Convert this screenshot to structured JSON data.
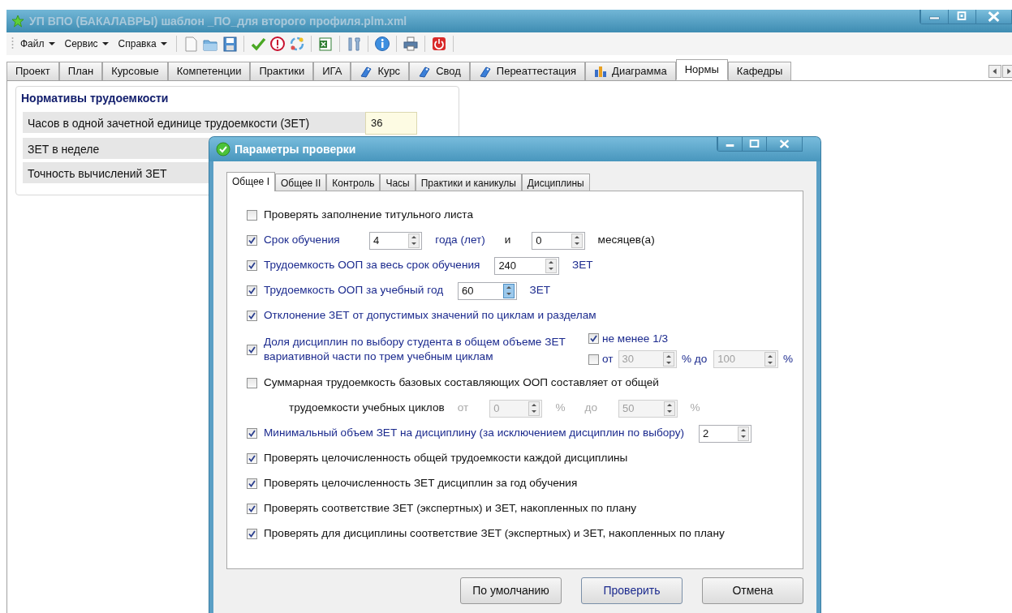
{
  "window": {
    "title": "УП ВПО (БАКАЛАВРЫ) шаблон _ПО_для второго профиля.plm.xml"
  },
  "menu": [
    {
      "label": "Файл"
    },
    {
      "label": "Сервис"
    },
    {
      "label": "Справка"
    }
  ],
  "tabs": [
    {
      "label": "Проект",
      "kind": "plain",
      "selected": false
    },
    {
      "label": "План",
      "kind": "plain",
      "selected": false
    },
    {
      "label": "Курсовые",
      "kind": "plain",
      "selected": false
    },
    {
      "label": "Компетенции",
      "kind": "plain",
      "selected": false
    },
    {
      "label": "Практики",
      "kind": "plain",
      "selected": false
    },
    {
      "label": "ИГА",
      "kind": "plain",
      "selected": false
    },
    {
      "label": "Курс",
      "kind": "tag",
      "selected": false
    },
    {
      "label": "Свод",
      "kind": "tag",
      "selected": false
    },
    {
      "label": "Переаттестация",
      "kind": "tag",
      "selected": false
    },
    {
      "label": "Диаграмма",
      "kind": "chart",
      "selected": false
    },
    {
      "label": "Нормы",
      "kind": "plain",
      "selected": true
    },
    {
      "label": "Кафедры",
      "kind": "plain",
      "selected": false
    }
  ],
  "norms": {
    "title": "Нормативы трудоемкости",
    "rows": [
      {
        "label": "Часов в одной зачетной единице трудоемкости (ЗЕТ)",
        "value": "36"
      },
      {
        "label": "ЗЕТ в неделе"
      },
      {
        "label": "Точность вычислений ЗЕТ"
      }
    ]
  },
  "dialog": {
    "title": "Параметры проверки",
    "tabs": [
      {
        "label": "Общее I",
        "selected": true
      },
      {
        "label": "Общее II",
        "selected": false
      },
      {
        "label": "Контроль",
        "selected": false
      },
      {
        "label": "Часы",
        "selected": false
      },
      {
        "label": "Практики и каникулы",
        "selected": false
      },
      {
        "label": "Дисциплины",
        "selected": false
      }
    ],
    "rows": [
      {
        "kind": "check",
        "checked": false,
        "accent": false,
        "label": "Проверять заполнение титульного листа"
      },
      {
        "kind": "check",
        "checked": true,
        "accent": true,
        "label": "Срок обучения",
        "items": [
          {
            "kind": "spin",
            "value": "4",
            "disabled": false,
            "hover": false
          },
          {
            "kind": "text",
            "text": "года (лет)",
            "accent": true,
            "disabled": false
          },
          {
            "kind": "text",
            "text": "и",
            "accent": false,
            "disabled": false
          },
          {
            "kind": "spin",
            "value": "0",
            "disabled": false,
            "hover": false
          },
          {
            "kind": "text",
            "text": "месяцев(а)",
            "accent": false,
            "disabled": false
          }
        ]
      },
      {
        "kind": "check",
        "checked": true,
        "accent": true,
        "label": "Трудоемкость ООП за весь срок обучения",
        "items": [
          {
            "kind": "spin",
            "value": "240",
            "disabled": false,
            "hover": false
          },
          {
            "kind": "text",
            "text": "ЗЕТ",
            "accent": true,
            "disabled": false
          }
        ]
      },
      {
        "kind": "check",
        "checked": true,
        "accent": true,
        "label": "Трудоемкость ООП за учебный год",
        "items": [
          {
            "kind": "spin",
            "value": "60",
            "disabled": false,
            "hover": true
          },
          {
            "kind": "text",
            "text": "ЗЕТ",
            "accent": true,
            "disabled": false
          }
        ]
      },
      {
        "kind": "check",
        "checked": true,
        "accent": true,
        "label": "Отклонение ЗЕТ от допустимых значений по циклам и разделам"
      },
      {
        "kind": "check",
        "checked": true,
        "accent": true,
        "label": "Доля дисциплин по выбору студента в общем объеме ЗЕТ вариативной части по трем учебным циклам",
        "options": [
          {
            "checked": true,
            "label": "не менее 1/3"
          },
          {
            "checked": false,
            "label": "от",
            "items": [
              {
                "kind": "spin",
                "value": "30",
                "disabled": true,
                "hover": false
              },
              {
                "kind": "text",
                "text": "% до",
                "accent": true,
                "disabled": false
              },
              {
                "kind": "spin",
                "value": "100",
                "disabled": true,
                "hover": false
              },
              {
                "kind": "text",
                "text": "%",
                "accent": true,
                "disabled": false
              }
            ]
          }
        ]
      },
      {
        "kind": "check",
        "checked": false,
        "accent": false,
        "label": "Суммарная трудоемкость базовых составляющих ООП составляет от общей"
      },
      {
        "kind": "indent",
        "label": "трудоемкости учебных циклов",
        "items": [
          {
            "kind": "text",
            "text": "от",
            "accent": false,
            "disabled": true
          },
          {
            "kind": "spin",
            "value": "0",
            "disabled": true,
            "hover": false
          },
          {
            "kind": "text",
            "text": "%",
            "accent": false,
            "disabled": true
          },
          {
            "kind": "text",
            "text": "до",
            "accent": false,
            "disabled": true
          },
          {
            "kind": "spin",
            "value": "50",
            "disabled": true,
            "hover": false
          },
          {
            "kind": "text",
            "text": "%",
            "accent": false,
            "disabled": true
          }
        ]
      },
      {
        "kind": "check",
        "checked": true,
        "accent": true,
        "label": "Минимальный объем ЗЕТ на дисциплину (за исключением дисциплин по выбору)",
        "items": [
          {
            "kind": "spin",
            "value": "2",
            "disabled": false,
            "hover": false
          }
        ]
      },
      {
        "kind": "check",
        "checked": true,
        "accent": false,
        "label": "Проверять целочисленность общей трудоемкости каждой дисциплины"
      },
      {
        "kind": "check",
        "checked": true,
        "accent": false,
        "label": "Проверять целочисленность ЗЕТ дисциплин за год обучения"
      },
      {
        "kind": "check",
        "checked": true,
        "accent": false,
        "label": "Проверять соответствие ЗЕТ (экспертных) и ЗЕТ, накопленных по плану"
      },
      {
        "kind": "check",
        "checked": true,
        "accent": false,
        "label": "Проверять для дисциплины соответствие ЗЕТ (экспертных) и ЗЕТ, накопленных по плану"
      }
    ],
    "buttons": [
      {
        "label": "По умолчанию",
        "default": false
      },
      {
        "label": "Проверить",
        "default": true
      },
      {
        "label": "Отмена",
        "default": false
      }
    ]
  }
}
